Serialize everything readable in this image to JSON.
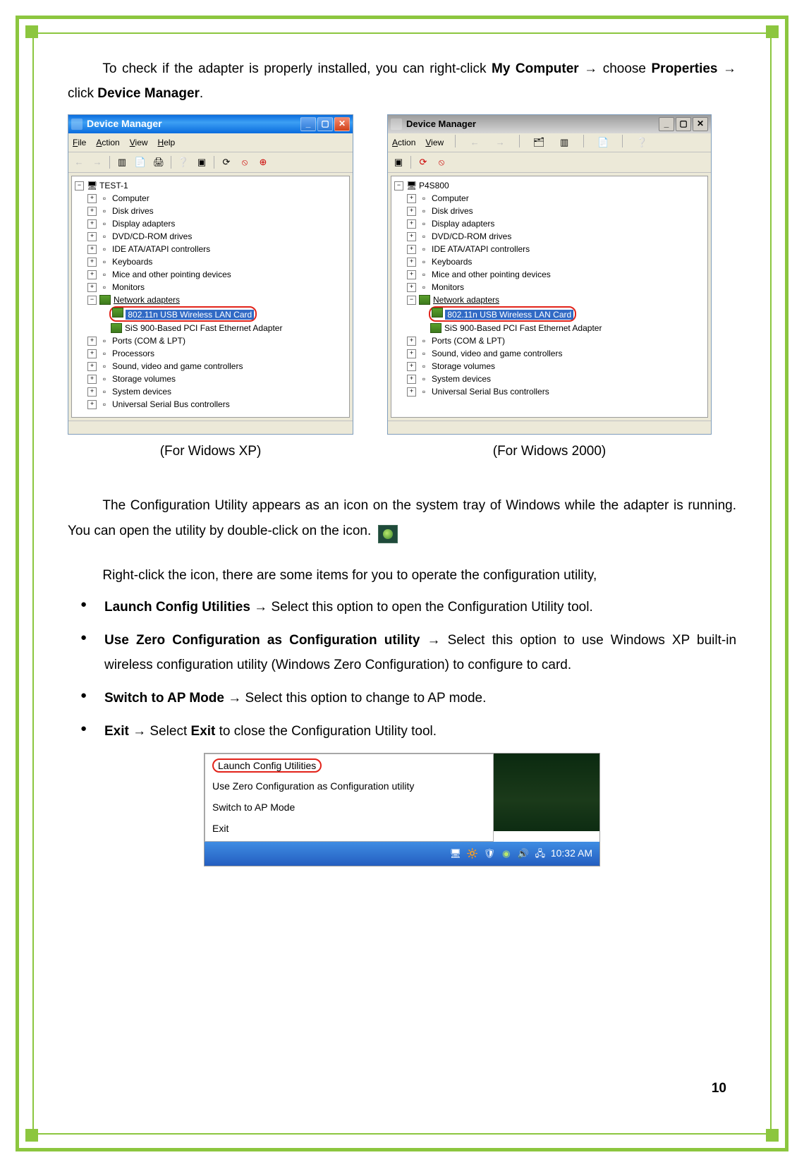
{
  "intro_text_before_my_computer": "To check if the adapter is properly installed, you can right-click ",
  "my_computer": "My Computer",
  "arrow": " → ",
  "choose": " choose ",
  "properties": "Properties",
  "click_word": " click ",
  "device_manager": "Device Manager",
  "period": ".",
  "xp_window": {
    "title": "Device Manager",
    "menu": [
      "File",
      "Action",
      "View",
      "Help"
    ],
    "root": "TEST-1",
    "items": [
      "Computer",
      "Disk drives",
      "Display adapters",
      "DVD/CD-ROM drives",
      "IDE ATA/ATAPI controllers",
      "Keyboards",
      "Mice and other pointing devices",
      "Monitors"
    ],
    "net_adapters": "Network adapters",
    "highlight_card": "802.11n USB Wireless LAN Card",
    "nic2": "SiS 900-Based PCI Fast Ethernet Adapter",
    "items2": [
      "Ports (COM & LPT)",
      "Processors",
      "Sound, video and game controllers",
      "Storage volumes",
      "System devices",
      "Universal Serial Bus controllers"
    ],
    "caption": "(For Widows XP)"
  },
  "w2k_window": {
    "title": "Device Manager",
    "menu": [
      "Action",
      "View"
    ],
    "root": "P4S800",
    "items": [
      "Computer",
      "Disk drives",
      "Display adapters",
      "DVD/CD-ROM drives",
      "IDE ATA/ATAPI controllers",
      "Keyboards",
      "Mice and other pointing devices",
      "Monitors"
    ],
    "net_adapters": "Network adapters",
    "highlight_card": "802.11n USB Wireless LAN Card",
    "nic2": "SiS 900-Based PCI Fast Ethernet Adapter",
    "items2": [
      "Ports (COM & LPT)",
      "Sound, video and game controllers",
      "Storage volumes",
      "System devices",
      "Universal Serial Bus controllers"
    ],
    "caption": "(For Widows 2000)"
  },
  "para2_a": "The Configuration Utility appears as an icon on the system tray of Windows while the adapter is running. You can open the utility by double-click on the icon.",
  "para3": "Right-click the icon, there are some items for you to operate the configuration utility,",
  "bullets": {
    "b1_name": "Launch Config Utilities",
    "b1_rest": " Select this option to open the Configuration Utility tool.",
    "b2_name": "Use Zero Configuration as Configuration utility",
    "b2_rest": " Select this option to use Windows XP built-in wireless configuration utility (Windows Zero Configuration) to configure to card.",
    "b3_name": "Switch to AP Mode",
    "b3_rest": " Select this option to change to AP mode.",
    "b4_name": "Exit",
    "b4_mid": " Select ",
    "b4_name2": "Exit",
    "b4_rest": " to close the Configuration Utility tool."
  },
  "systray": {
    "items": [
      "Launch Config Utilities",
      "Use Zero Configuration as Configuration utility",
      "Switch to AP Mode",
      "Exit"
    ],
    "clock": "10:32 AM"
  },
  "page_number": "10"
}
